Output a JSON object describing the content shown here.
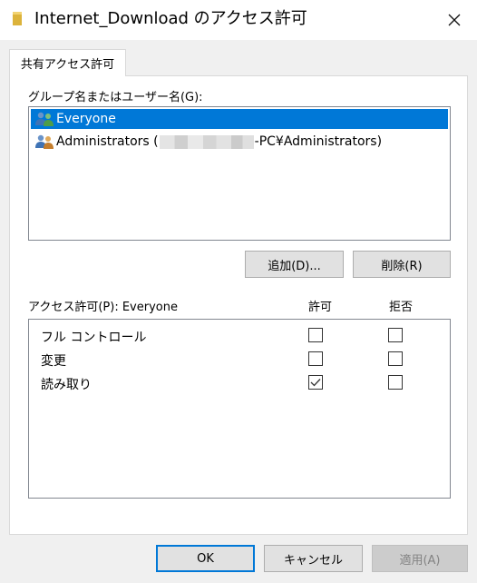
{
  "window": {
    "title": "Internet_Download のアクセス許可",
    "close_glyph": "✕"
  },
  "tabs": [
    {
      "label": "共有アクセス許可",
      "active": true
    }
  ],
  "groups": {
    "label": "グループ名またはユーザー名(G):",
    "items": [
      {
        "name": "Everyone",
        "selected": true
      },
      {
        "prefix": "Administrators (",
        "redacted": true,
        "suffix": "-PC¥Administrators)",
        "selected": false
      }
    ]
  },
  "group_buttons": {
    "add_label": "追加(D)...",
    "remove_label": "削除(R)"
  },
  "permissions": {
    "label": "アクセス許可(P): Everyone",
    "allow_header": "許可",
    "deny_header": "拒否",
    "rows": [
      {
        "name": "フル コントロール",
        "allow": false,
        "deny": false
      },
      {
        "name": "変更",
        "allow": false,
        "deny": false
      },
      {
        "name": "読み取り",
        "allow": true,
        "deny": false
      }
    ]
  },
  "footer": {
    "ok_label": "OK",
    "cancel_label": "キャンセル",
    "apply_label": "適用(A)",
    "apply_enabled": false
  },
  "colors": {
    "selection": "#0078d7",
    "default_button_border": "#0078d7",
    "folder_icon": "#dcb33b"
  },
  "icons": {
    "title": "folder-icon",
    "users": "user-group-icon",
    "check": "check-icon",
    "close": "close-icon"
  }
}
